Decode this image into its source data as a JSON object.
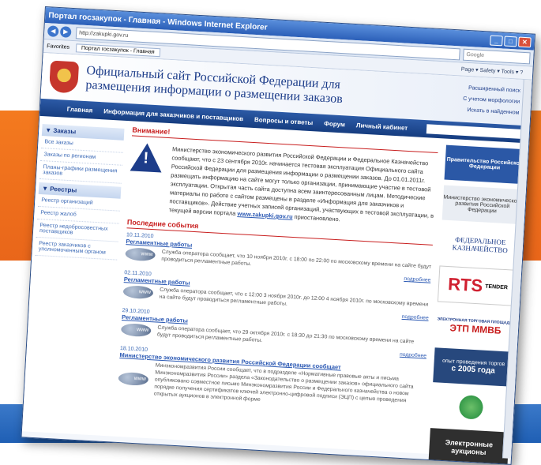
{
  "browser": {
    "title": "Портал госзакупок - Главная - Windows Internet Explorer",
    "url": "http://zakupki.gov.ru",
    "search_placeholder": "Google",
    "favorites_label": "Favorites",
    "tab_label": "Портал госзакупок - Главная",
    "command_items": "Page ▾  Safety ▾  Tools ▾  ?"
  },
  "site": {
    "title_line1": "Официальный сайт Российской Федерации для",
    "title_line2": "размещения информации о размещении заказов",
    "header_links": [
      "Расширенный поиск",
      "С учетом морфологии",
      "Искать в найденном"
    ],
    "menu": [
      "Главная",
      "Информация для заказчиков и поставщиков",
      "Вопросы и ответы",
      "Форум",
      "Личный кабинет"
    ],
    "left_sections": [
      {
        "title": "▼ Заказы",
        "items": [
          "Все заказы",
          "Заказы по регионам",
          "Планы-графики размещения заказов"
        ]
      },
      {
        "title": "▼ Реестры",
        "items": [
          "Реестр организаций",
          "Реестр жалоб",
          "Реестр недобросовестных поставщиков",
          "Реестр заказчиков с уполномоченным органом"
        ]
      }
    ],
    "warning_title": "Внимание!",
    "warning_text": "Министерство экономического развития Российской Федерации и Федеральное Казначейство сообщают, что с 23 сентября 2010г. начинается тестовая эксплуатация Официального сайта Российской Федерации для размещения информации о размещении заказов. До 01.01.2011г. размещать информацию на сайте могут только организации, принимающие участие в тестовой эксплуатации. Открытая часть сайта доступна всем заинтересованным лицам. Методические материалы по работе с сайтом размещены в разделе «Информация для заказчиков и поставщиков». Действие учетных записей организаций, участвующих в тестовой эксплуатации, в текущей версии портала",
    "warning_link": "www.zakupki.gov.ru",
    "warning_tail": "приостановлено.",
    "events_title": "Последние события",
    "events": [
      {
        "date": "10.11.2010",
        "head": "Регламентные работы",
        "text": "Служба оператора сообщает, что 10 ноября 2010г. с 18:00 по 22:00 по московскому времени на сайте будут проводиться регламентные работы.",
        "more": "подробнее"
      },
      {
        "date": "02.11.2010",
        "head": "Регламентные работы",
        "text": "Служба оператора сообщает, что с 12:00 3 ноября 2010г. до 12:00 4 ноября 2010г. по московскому времени на сайте будут проводиться регламентные работы.",
        "more": "подробнее"
      },
      {
        "date": "29.10.2010",
        "head": "Регламентные работы",
        "text": "Служба оператора сообщает, что 29 октября 2010г. с 18:30 до 21:30 по московскому времени на сайте будут проводиться регламентные работы.",
        "more": "подробнее"
      },
      {
        "date": "18.10.2010",
        "head": "Министерство экономического развития Российской Федерации сообщает",
        "text": "Минэкономразвития России сообщает, что в подразделе «Нормативные правовые акты и письма Минэкономразвития России» раздела «Законодательство о размещении заказов» официального сайта опубликовано совместное письмо Минэкономразвития России и Федерального казначейства о новом порядке получения сертификатов ключей электронно-цифровой подписи (ЭЦП) с целью проведения открытых аукционов в электронной форме",
        "more": ""
      }
    ],
    "banners": {
      "b1": "Правительство Российской Федерации",
      "b2": "Министерство экономического развития Российской Федерации",
      "b3": "ФЕДЕРАЛЬНОЕ КАЗНАЧЕЙСТВО",
      "b4": "RTS",
      "b4_small": "TENDER",
      "b5": "ЭТП ММВБ",
      "b5_small": "ЭЛЕКТРОННАЯ ТОРГОВАЯ ПЛОЩАДКА",
      "b6_line1": "опыт проведения торгов",
      "b6_line2": "с 2005 года",
      "b8": "Электронные аукционы"
    }
  }
}
